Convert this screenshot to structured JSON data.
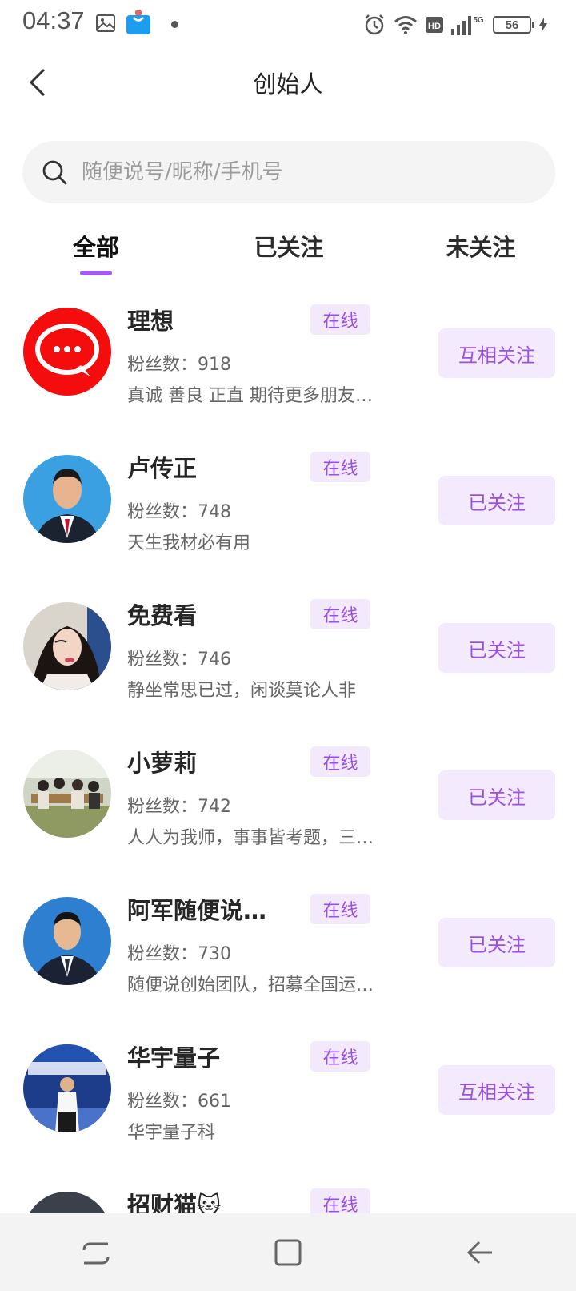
{
  "status_bar": {
    "time": "04:37",
    "battery": "56"
  },
  "header": {
    "title": "创始人"
  },
  "search": {
    "placeholder": "随便说号/昵称/手机号"
  },
  "tabs": [
    {
      "label": "全部",
      "active": true
    },
    {
      "label": "已关注",
      "active": false
    },
    {
      "label": "未关注",
      "active": false
    }
  ],
  "fans_label": "粉丝数：",
  "users": [
    {
      "name": "理想",
      "status": "在线",
      "fans": "918",
      "bio": "真诚 善良 正直 期待更多朋友…",
      "follow": "互相关注"
    },
    {
      "name": "卢传正",
      "status": "在线",
      "fans": "748",
      "bio": "天生我材必有用",
      "follow": "已关注"
    },
    {
      "name": "免费看",
      "status": "在线",
      "fans": "746",
      "bio": "静坐常思已过，闲谈莫论人非",
      "follow": "已关注"
    },
    {
      "name": "小萝莉",
      "status": "在线",
      "fans": "742",
      "bio": "人人为我师，事事皆考题，三…",
      "follow": "已关注"
    },
    {
      "name": "阿军随便说…",
      "status": "在线",
      "fans": "730",
      "bio": "随便说创始团队，招募全国运…",
      "follow": "已关注"
    },
    {
      "name": "华宇量子",
      "status": "在线",
      "fans": "661",
      "bio": "华宇量子科",
      "follow": "互相关注"
    },
    {
      "name": "招财猫🐱",
      "status": "在线",
      "fans": "",
      "bio": "",
      "follow": ""
    }
  ],
  "colors": {
    "accent": "#9a4fe5",
    "accent_bg": "#f2e9fd",
    "tab_indicator": "#a15cf0"
  }
}
